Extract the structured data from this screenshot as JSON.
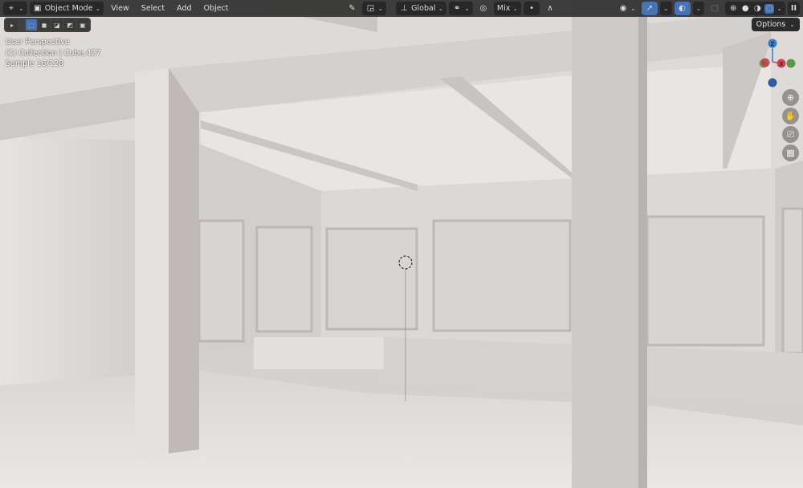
{
  "header": {
    "editor_type_icon": "3d-viewport-icon",
    "mode": "Object Mode",
    "menus": [
      "View",
      "Select",
      "Add",
      "Object"
    ],
    "transform_orientation": "Global",
    "proportional_falloff": "Mix",
    "pause_label": "II"
  },
  "toolbar": {
    "tools": [
      "tweak",
      "select-box",
      "extend",
      "subtract",
      "invert",
      "intersect"
    ]
  },
  "overlay_info": {
    "view": "User Perspective",
    "object": "(1) Collection | Cube.427",
    "sample": "Sample 16/128"
  },
  "options_label": "Options",
  "gizmo": {
    "z": "Z",
    "y": "Y",
    "x": "X",
    "colors": {
      "x": "#d0404f",
      "y": "#6aa84f",
      "z": "#2f7fd0"
    }
  },
  "accent": "#4772b3"
}
